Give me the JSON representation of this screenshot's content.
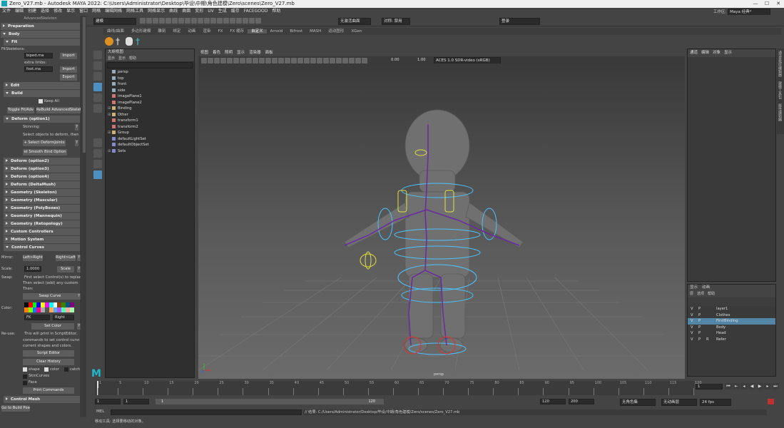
{
  "titlebar": {
    "title": "Zero_V27.mb - Autodesk MAYA 2022: C:\\Users\\Administrator\\Desktop\\毕设\\中期\\角色建模\\Zero\\scenes\\Zero_V27.mb",
    "min": "—",
    "max": "☐",
    "close": "✕"
  },
  "menubar": {
    "items": [
      "文件",
      "编辑",
      "创建",
      "选择",
      "修改",
      "显示",
      "窗口",
      "网格",
      "编辑网格",
      "网格工具",
      "网格显示",
      "曲线",
      "曲面",
      "变形",
      "UV",
      "生成",
      "缓存",
      "FACEGOOD",
      "帮助"
    ],
    "workspace_label": "工作区:",
    "workspace_value": "Maya 经典*"
  },
  "statusline": {
    "mode": "建模",
    "live_surface": "无激活曲面",
    "symmetry": "对称: 禁用",
    "login": "登录"
  },
  "shelf_tabs": [
    "曲线/曲面",
    "多边形建模",
    "雕刻",
    "绑定",
    "动画",
    "渲染",
    "FX",
    "FX 缓存",
    "自定义",
    "Arnold",
    "Bifrost",
    "MASH",
    "运动图形",
    "XGen"
  ],
  "shelf_active": "自定义",
  "left_panel": {
    "header": "AdvancedSkeleton",
    "preparation": "Preparation",
    "body": "Body",
    "fit": "Fit",
    "fitskeletons_label": "FitSkeletons:",
    "fitskeleton_value": "biped.ma",
    "import1": "Import",
    "extra_limbs_label": "extra limbs:",
    "extra_limb_value": "foot.ma",
    "import2": "Import",
    "export": "Export",
    "edit": "Edit",
    "build": "Build",
    "keep_all": "Keep All",
    "toggle_fit": "Toggle Fit/Adv",
    "rebuild": "ReBuild AdvancedSkelet",
    "deform_opt1": "Deform      (option1)",
    "skinning_label": "Skinning:",
    "skinning_hint": "Select objects to deform, then",
    "select_deform_joints": "+ Select DeformJoints",
    "smooth_bind": "et Smooth Bind Option",
    "sections": [
      "Deform      (option2)",
      "Deform      (option3)",
      "Deform      (option4)",
      "Deform      (DeltaMush)",
      "Geometry  (Skeleton)",
      "Geometry  (Muscular)",
      "Geometry  (PolyBoxes)",
      "Geometry  (Mannequin)",
      "Geometry  (Retopology)",
      "Custom Controllers",
      "Motion System"
    ],
    "control_curves": "Control Curves",
    "mirror_label": "Mirror:",
    "mirror_lr": "Left>Right",
    "mirror_rl": "Right>Left",
    "scale_label": "Scale:",
    "scale_value": "1.0000",
    "scale_btn": "Scale",
    "swap_label": "Swap:",
    "swap_text1": "First select Control(s) to replace",
    "swap_text2": "Then select (add) any custom s",
    "swap_text3": "Then:",
    "swap_curve": "Swap Curve",
    "color_label": "Color:",
    "fk_value": "FK",
    "side_value": "Right",
    "set_color": "Set Color",
    "reuse_label": "Re-use:",
    "reuse_text1": "This will print in ScriptEditor,",
    "reuse_text2": "commands to set control curve",
    "reuse_text3": "current shapes and colors.",
    "script_editor": "Script Editor",
    "clear_history": "Clear History",
    "chk_shape": "shape",
    "chk_color": "color",
    "chk_catch": "catch",
    "chk_skincurves": "SkinCurves",
    "chk_face": "Face",
    "print_commands": "Print Commands",
    "control_mesh": "Control Mesh",
    "to_build_pos": "Go to Build Pose",
    "palette": [
      "#000000",
      "#ff0000",
      "#00ff00",
      "#0000ff",
      "#ffff00",
      "#ff00ff",
      "#00ffff",
      "#ffffff",
      "#7f3f00",
      "#3f7f00",
      "#00557f",
      "#7f007f",
      "#ff7f00",
      "#7fff00",
      "#007fff",
      "#ff007f",
      "#aaaaaa",
      "#555555",
      "#ffaa55",
      "#55aaff",
      "#aa55ff",
      "#55ffaa",
      "#ffaaaa",
      "#aaffaa"
    ]
  },
  "outliner": {
    "title": "大纲视图",
    "menu": [
      "显示",
      "显示",
      "帮助"
    ],
    "items": [
      {
        "label": "persp",
        "kind": "cam",
        "exp": ""
      },
      {
        "label": "top",
        "kind": "cam",
        "exp": ""
      },
      {
        "label": "front",
        "kind": "cam",
        "exp": ""
      },
      {
        "label": "side",
        "kind": "cam",
        "exp": ""
      },
      {
        "label": "imagePlane1",
        "kind": "img",
        "exp": ""
      },
      {
        "label": "imagePlane2",
        "kind": "img",
        "exp": ""
      },
      {
        "label": "Binding",
        "kind": "grp",
        "exp": "⊞"
      },
      {
        "label": "Other",
        "kind": "grp",
        "exp": "⊞"
      },
      {
        "label": "transform1",
        "kind": "img",
        "exp": ""
      },
      {
        "label": "transform2",
        "kind": "img",
        "exp": ""
      },
      {
        "label": "Group",
        "kind": "grp",
        "exp": "⊞"
      },
      {
        "label": "defaultLightSet",
        "kind": "set",
        "exp": ""
      },
      {
        "label": "defaultObjectSet",
        "kind": "set",
        "exp": ""
      },
      {
        "label": "Sets",
        "kind": "set",
        "exp": "⊞"
      }
    ]
  },
  "viewport": {
    "menu": [
      "视图",
      "着色",
      "照明",
      "显示",
      "渲染器",
      "面板"
    ],
    "exposure": "0.00",
    "gamma": "1.00",
    "colorspace": "ACES 1.0 SDR-video (sRGB)",
    "camera_label": "persp"
  },
  "right_panel": {
    "menu": [
      "通道",
      "编辑",
      "对象",
      "显示"
    ],
    "side_tabs": [
      "通道盒/层编辑器",
      "建模工具包",
      "属性编辑器"
    ]
  },
  "layers": {
    "tabs": [
      "显示",
      "动画"
    ],
    "menu": [
      "层",
      "选项",
      "帮助"
    ],
    "rows": [
      {
        "v": "V",
        "p": "P",
        "r": "",
        "name": "layer1",
        "sel": false
      },
      {
        "v": "V",
        "p": "P",
        "r": "",
        "name": "Clothes",
        "sel": false
      },
      {
        "v": "V",
        "p": "P",
        "r": "",
        "name": "FirstBinding",
        "sel": true
      },
      {
        "v": "V",
        "p": "P",
        "r": "",
        "name": "Body",
        "sel": false
      },
      {
        "v": "V",
        "p": "P",
        "r": "",
        "name": "Head",
        "sel": false
      },
      {
        "v": "V",
        "p": "P",
        "r": "R",
        "name": "Refer",
        "sel": false
      }
    ]
  },
  "timeline": {
    "ticks": [
      "1",
      "5",
      "10",
      "15",
      "20",
      "25",
      "30",
      "35",
      "40",
      "45",
      "50",
      "55",
      "60",
      "65",
      "70",
      "75",
      "80",
      "85",
      "90",
      "95",
      "100",
      "105",
      "110",
      "115",
      "120"
    ],
    "current_frame": "1"
  },
  "range": {
    "start": "1",
    "inner_start": "1",
    "slider_start": "1",
    "slider_end": "120",
    "inner_end": "120",
    "end": "200",
    "char_set": "无角色集",
    "anim_layer": "无动画层",
    "fps": "24 fps"
  },
  "cmdline": {
    "lang": "MEL",
    "result": "// 结果: C:/Users/Administrator/Desktop/毕设/中期/角色建模/Zero/scenes/Zero_V27.mb"
  },
  "helpline": {
    "text": "移动工具: 选择要移动的对象。"
  }
}
